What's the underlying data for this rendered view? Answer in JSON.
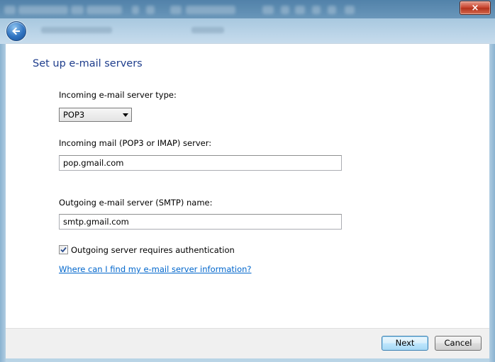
{
  "window": {
    "close_glyph": "×"
  },
  "nav": {
    "back_icon": "back-arrow-icon"
  },
  "page": {
    "title": "Set up e-mail servers"
  },
  "incoming_type": {
    "label": "Incoming e-mail server type:",
    "selected": "POP3"
  },
  "incoming_server": {
    "label": "Incoming mail (POP3 or IMAP) server:",
    "value": "pop.gmail.com"
  },
  "outgoing_server": {
    "label": "Outgoing e-mail server (SMTP) name:",
    "value": "smtp.gmail.com"
  },
  "auth": {
    "label": "Outgoing server requires authentication",
    "checked": true
  },
  "help_link": "Where can I find my e-mail server information?",
  "footer": {
    "next_label": "Next",
    "cancel_label": "Cancel"
  },
  "colors": {
    "title": "#1e3d8c",
    "link": "#0066cc"
  }
}
